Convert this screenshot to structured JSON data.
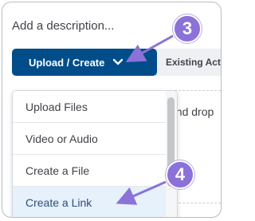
{
  "editor": {
    "placeholder": "Add a description..."
  },
  "toolbar": {
    "upload_label": "Upload / Create",
    "existing_label": "Existing Activities"
  },
  "dropzone": {
    "text": "and drop"
  },
  "menu": {
    "items": [
      {
        "label": "Upload Files"
      },
      {
        "label": "Video or Audio"
      },
      {
        "label": "Create a File"
      },
      {
        "label": "Create a Link"
      }
    ]
  },
  "callouts": {
    "step_a": "3",
    "step_b": "4"
  },
  "colors": {
    "primary_button": "#004d8a",
    "callout": "#8b72d8",
    "highlight_row": "#e6f1fb"
  },
  "icons": {
    "upload_chevron": "chevron-down-icon"
  }
}
